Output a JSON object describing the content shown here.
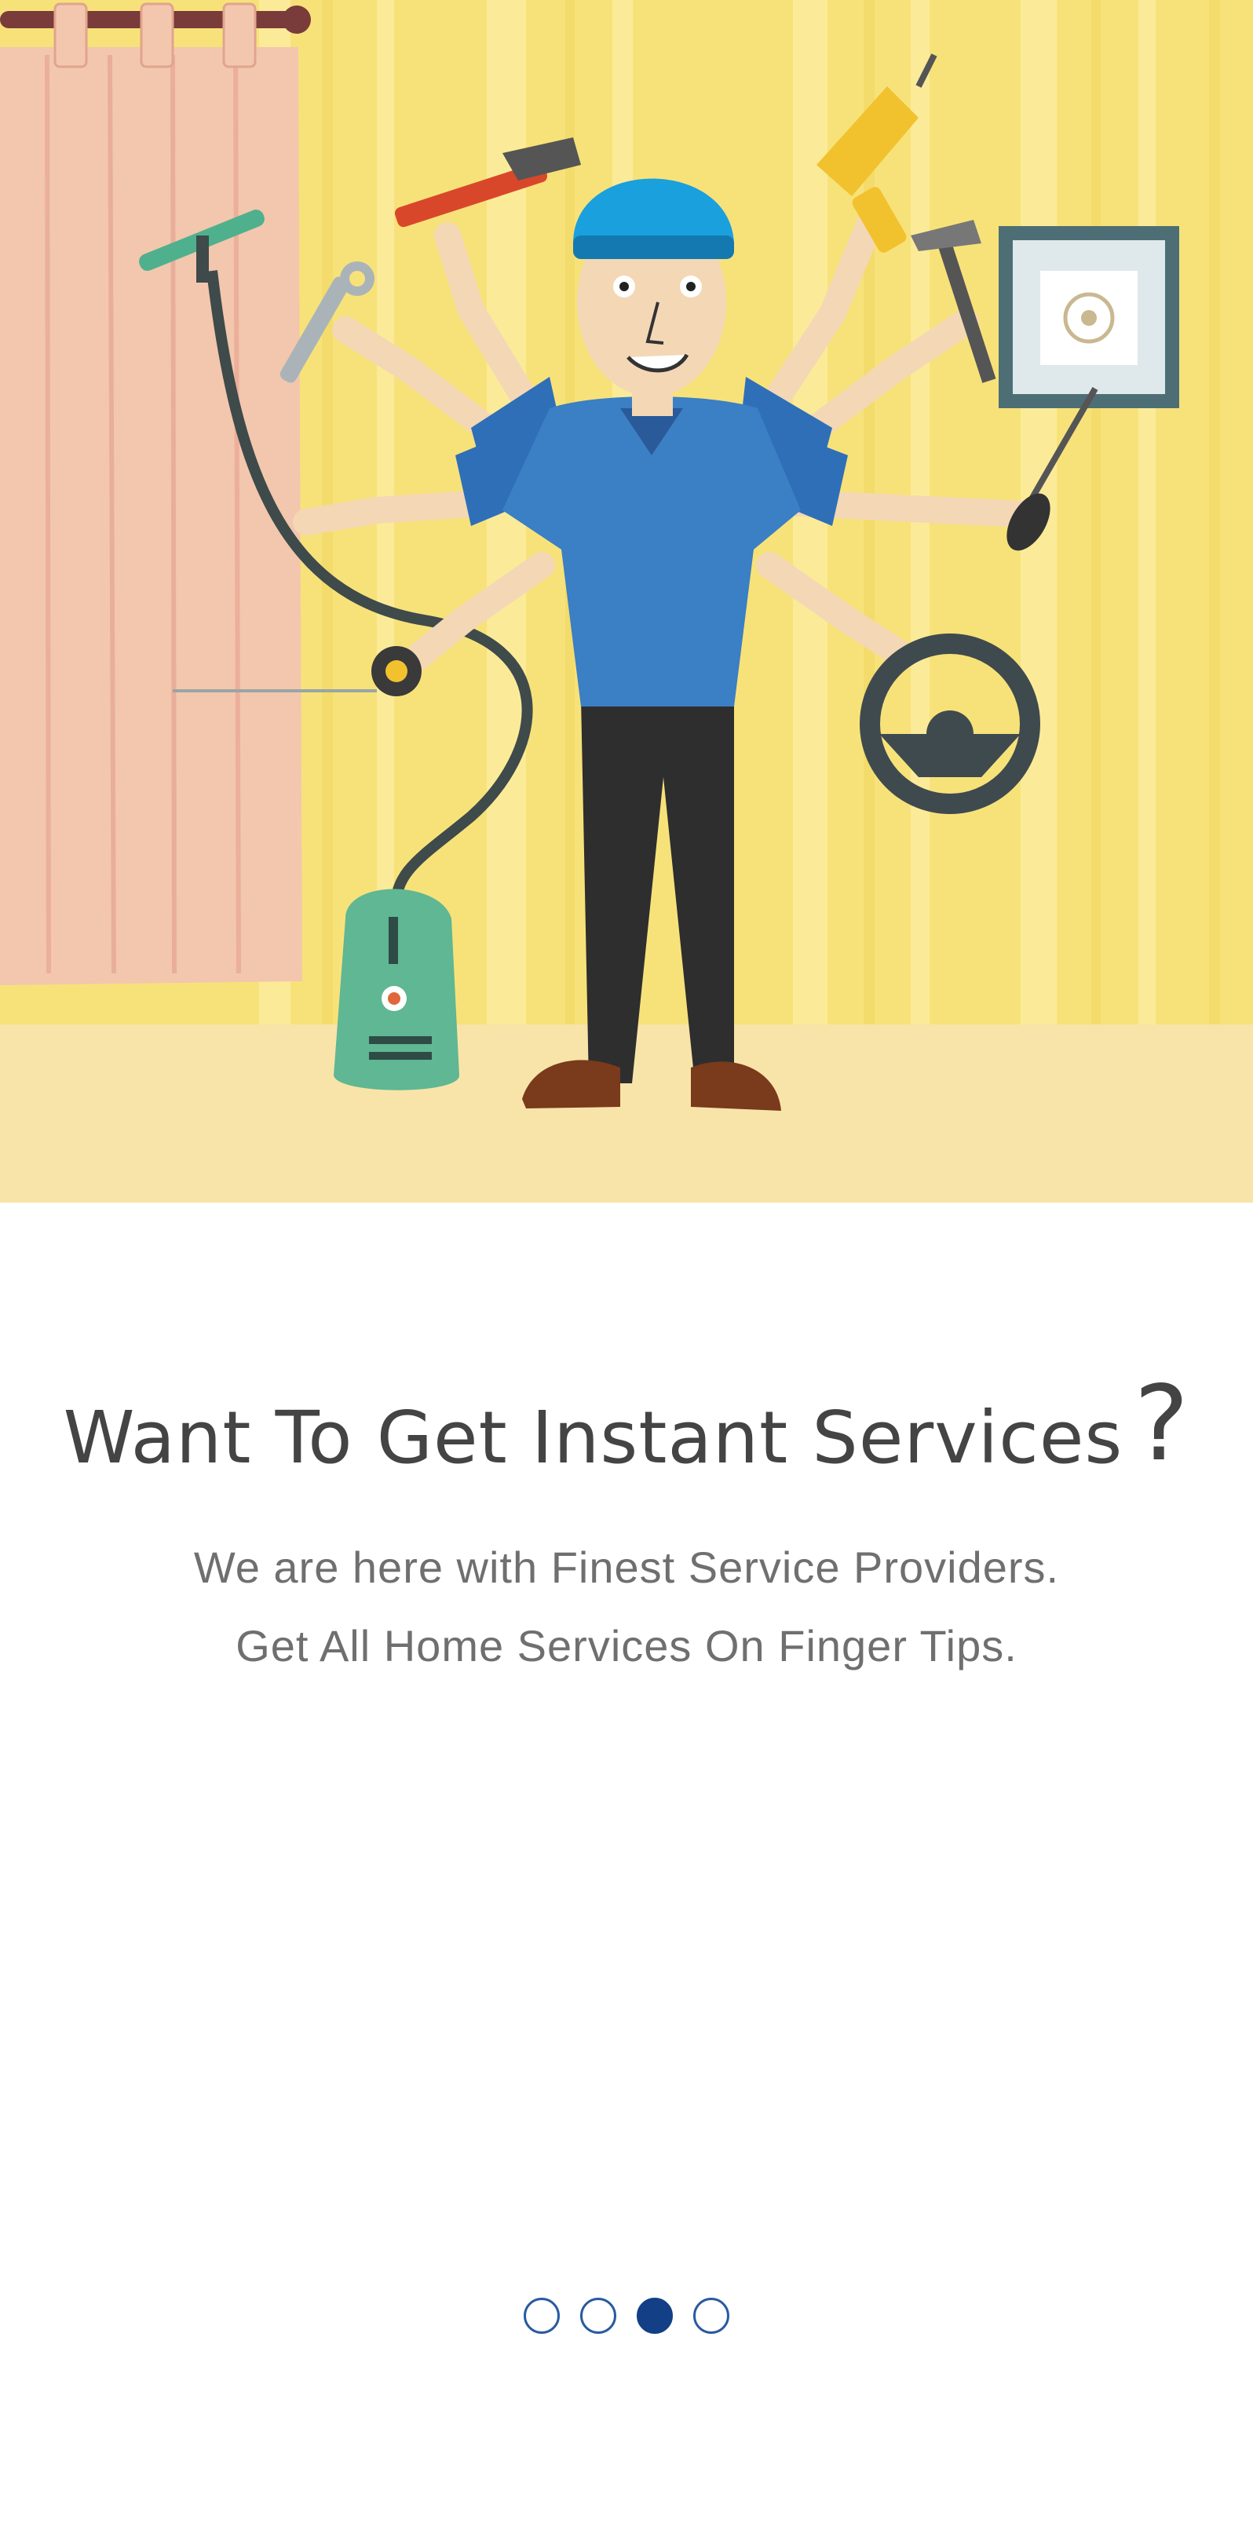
{
  "onboarding": {
    "title": "Want To Get Instant Services",
    "title_mark": "?",
    "subtitle_line1": "We are here with Finest Service Providers.",
    "subtitle_line2": "Get All Home Services On Finger Tips.",
    "page_count": 4,
    "active_page": 3
  },
  "illustration": {
    "subject": "multi-armed handyman holding home service tools",
    "icons": [
      "wrench-icon",
      "pipe-wrench-icon",
      "drill-icon",
      "hammer-icon",
      "screwdriver-icon",
      "squeegee-icon",
      "vacuum-icon",
      "tape-measure-icon",
      "steering-wheel-icon",
      "picture-frame-icon"
    ]
  },
  "colors": {
    "wall": "#f7e27a",
    "floor": "#f8e4a8",
    "shirt": "#3b7fc4",
    "title_text": "#444444",
    "subtitle_text": "#6f6f6f",
    "dot_active": "#123f86",
    "dot_border": "#2a5aa0"
  }
}
